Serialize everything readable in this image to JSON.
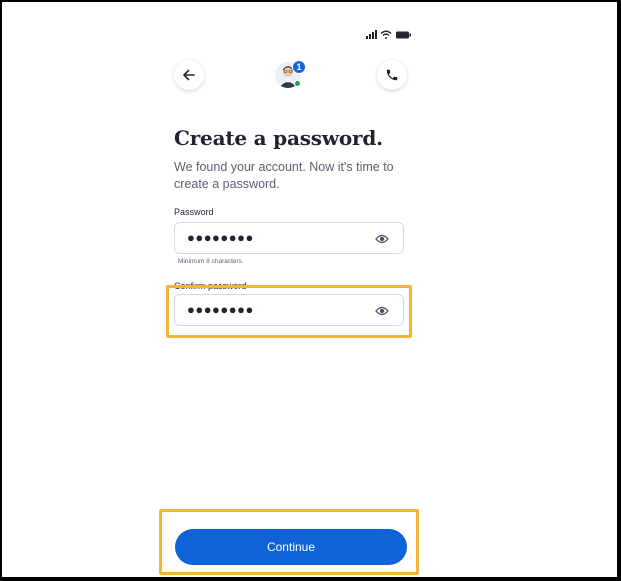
{
  "header": {
    "notification_count": "1"
  },
  "main": {
    "title": "Create a password.",
    "subtitle": "We found your account. Now it's time to create a password.",
    "password": {
      "label": "Password",
      "value": "●●●●●●●●",
      "hint": "Minimum 8 characters."
    },
    "confirm_password": {
      "label": "Confirm password",
      "value": "●●●●●●●●"
    },
    "continue_label": "Continue"
  },
  "icons": {
    "back": "arrow-left-icon",
    "phone": "phone-icon",
    "eye": "eye-icon",
    "status": [
      "signal-icon",
      "wifi-icon",
      "battery-icon"
    ]
  },
  "colors": {
    "primary": "#0d63d7",
    "highlight": "#f6b43a",
    "badge": "#1565d8",
    "online": "#1a9e50"
  }
}
